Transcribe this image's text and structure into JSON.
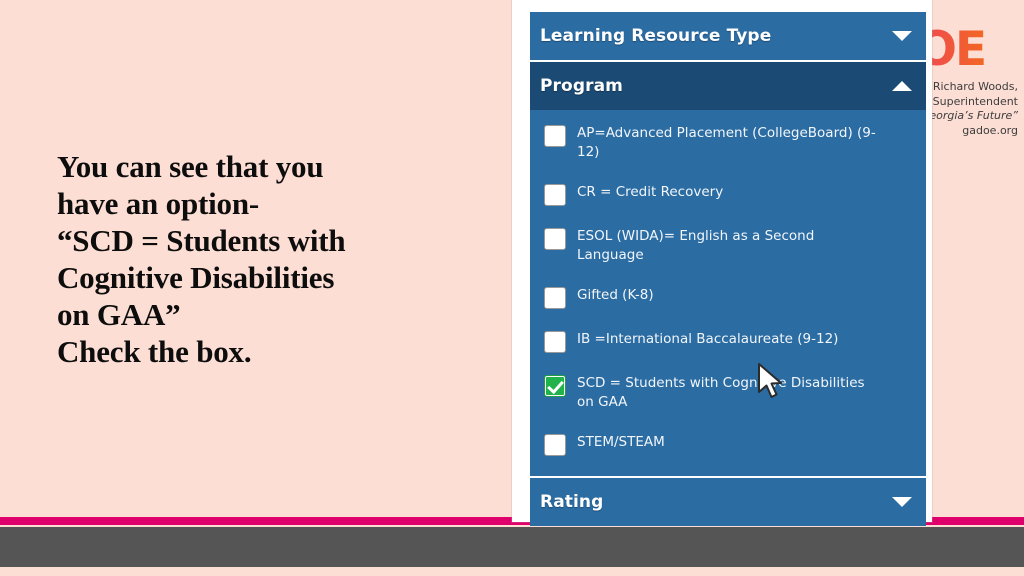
{
  "slide": {
    "background_color": "#fcded4",
    "accent_rule_color": "#e0006c",
    "footer_color": "#555555",
    "narration_lines": [
      "You can see that you",
      "have an option-",
      "“SCD = Students with",
      "Cognitive Disabilities",
      "on GAA”",
      "Check the box."
    ]
  },
  "logo": {
    "wordmark": "DOE",
    "tagline_line1": "Richard Woods,",
    "tagline_line2": "ol Superintendent",
    "tagline_line3": "Georgia’s Future”",
    "tagline_line4": "gadoe.org",
    "colors": {
      "wordmark_start": "#e8267a",
      "wordmark_end": "#f26722",
      "leaf_light": "#9ab33a",
      "leaf_dark": "#3f8a35",
      "peach": "#f26722"
    }
  },
  "screenshot": {
    "facets": {
      "learning_resource_type": {
        "title": "Learning Resource Type",
        "state": "collapsed",
        "chevron": "chevron-down-icon"
      },
      "program": {
        "title": "Program",
        "state": "expanded",
        "chevron": "chevron-up-icon",
        "options": [
          {
            "label": "AP=Advanced Placement (CollegeBoard) (9-12)",
            "checked": false
          },
          {
            "label": "CR = Credit Recovery",
            "checked": false
          },
          {
            "label": "ESOL (WIDA)= English as a Second Language",
            "checked": false
          },
          {
            "label": "Gifted (K-8)",
            "checked": false
          },
          {
            "label": "IB =International Baccalaureate (9-12)",
            "checked": false
          },
          {
            "label": "SCD = Students with Cognitive Disabilities on GAA",
            "checked": true
          },
          {
            "label": "STEM/STEAM",
            "checked": false
          }
        ]
      },
      "rating": {
        "title": "Rating",
        "state": "collapsed",
        "chevron": "chevron-down-icon"
      }
    },
    "colors": {
      "header_blue": "#2b6ca3",
      "header_blue_active": "#1b4a74",
      "checkbox_checked": "#22b24c",
      "card_background": "#ffffff"
    }
  }
}
